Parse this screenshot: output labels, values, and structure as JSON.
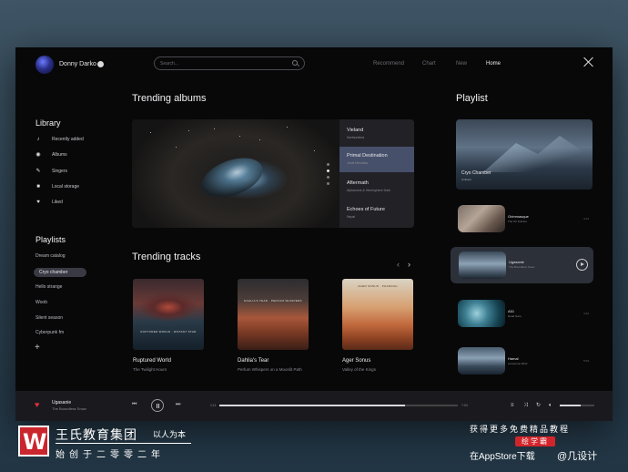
{
  "header": {
    "user_name": "Donny Darko",
    "search_placeholder": "Search...",
    "nav": [
      "Recommend",
      "Chart",
      "New",
      "Home"
    ],
    "active_nav": "Home"
  },
  "sidebar": {
    "library_title": "Library",
    "library_items": [
      {
        "icon": "music-note-icon",
        "label": "Recently added"
      },
      {
        "icon": "disc-icon",
        "label": "Albums"
      },
      {
        "icon": "microphone-icon",
        "label": "Singers"
      },
      {
        "icon": "folder-icon",
        "label": "Local storage"
      },
      {
        "icon": "heart-icon",
        "label": "Liked"
      }
    ],
    "playlists_title": "Playlists",
    "playlists": [
      "Dream catalog",
      "Cryo chamber",
      "Hello strange",
      "Woob",
      "Silent season",
      "Cyberpunk fm"
    ],
    "active_playlist": "Cryo chamber"
  },
  "trending_albums": {
    "title": "Trending albums",
    "items": [
      {
        "title": "Vieland",
        "subtitle": "Northumbria"
      },
      {
        "title": "Primal Destination",
        "subtitle": "Jesal Melodias"
      },
      {
        "title": "Aftermath",
        "subtitle": "Alphaxone & Hemisphere Dark"
      },
      {
        "title": "Echoes of Future",
        "subtitle": "Nepal"
      }
    ],
    "active_index": 1,
    "dot_count": 4,
    "active_dot": 1
  },
  "trending_tracks": {
    "title": "Trending tracks",
    "items": [
      {
        "title": "Ruptured World",
        "subtitle": "The Twilight Hours",
        "cover_text": "RUPTURED WORLD · DISTANT STAR"
      },
      {
        "title": "Dahlia's Tear",
        "subtitle": "Perfum Whispers on a Moonlit Path",
        "cover_text": "DAHLIA'S TEAR · PERFUM WHISPERS"
      },
      {
        "title": "Ager Sonus",
        "subtitle": "Valley of the Kings",
        "cover_text": "AGER SONUS · PHARAOH"
      }
    ]
  },
  "playlist_panel": {
    "title": "Playlist",
    "featured": {
      "title": "Cryo Chamber",
      "subtitle": "Ambient"
    },
    "items": [
      {
        "title": "Grimmasque",
        "subtitle": "The Ori Fractus",
        "duration": "4:14"
      },
      {
        "title": "Ugasanie",
        "subtitle": "The Boundless Snow",
        "duration": ""
      },
      {
        "title": "A51",
        "subtitle": "Dead Suns",
        "duration": "3:24"
      },
      {
        "title": "Hamal",
        "subtitle": "Lonesome Mind",
        "duration": "5:03"
      }
    ],
    "active_index": 1
  },
  "player": {
    "title": "Ugasanie",
    "subtitle": "The Boundless Snow",
    "elapsed": "1:11",
    "total": "7:04",
    "progress": 0.78,
    "volume": 0.6
  },
  "watermark": {
    "brand": "王氏教育集团",
    "slogan": "以人为本",
    "founded": "始创于二零零二年",
    "promo": "获得更多免费精品教程",
    "badge": "绘学霸",
    "store": "在AppStore下载",
    "handle": "@几设计"
  },
  "colors": {
    "app_bg": "#080809",
    "accent_heart": "#e0303a",
    "active_row": "#46506a",
    "watermark_red": "#c9262d"
  }
}
